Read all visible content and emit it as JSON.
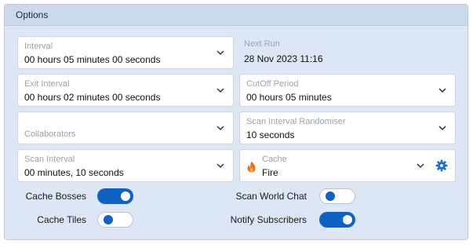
{
  "panel": {
    "title": "Options"
  },
  "fields": {
    "interval": {
      "label": "Interval",
      "value": "00 hours 05 minutes 00 seconds"
    },
    "next_run": {
      "label": "Next Run",
      "value": "28 Nov 2023 11:16"
    },
    "exit_interval": {
      "label": "Exit Interval",
      "value": "00 hours 02 minutes 00 seconds"
    },
    "cutoff_period": {
      "label": "CutOff Period",
      "value": "00 hours 05 minutes"
    },
    "collaborators": {
      "label": "Collaborators"
    },
    "scan_interval_randomiser": {
      "label": "Scan Interval Randomiser",
      "value": "10 seconds"
    },
    "scan_interval": {
      "label": "Scan Interval",
      "value": "00 minutes, 10 seconds"
    },
    "cache": {
      "label": "Cache",
      "value": "Fire",
      "icon": "fire-icon",
      "settings_icon": "gear-icon"
    }
  },
  "toggles": {
    "cache_bosses": {
      "label": "Cache Bosses",
      "on": true
    },
    "cache_tiles": {
      "label": "Cache Tiles",
      "on": false
    },
    "scan_world_chat": {
      "label": "Scan World Chat",
      "on": false
    },
    "notify_subscribers": {
      "label": "Notify Subscribers",
      "on": true
    }
  },
  "colors": {
    "accent": "#0f62c5",
    "panel_bg": "#dce6f4",
    "header_bg": "#cbd9ef"
  }
}
